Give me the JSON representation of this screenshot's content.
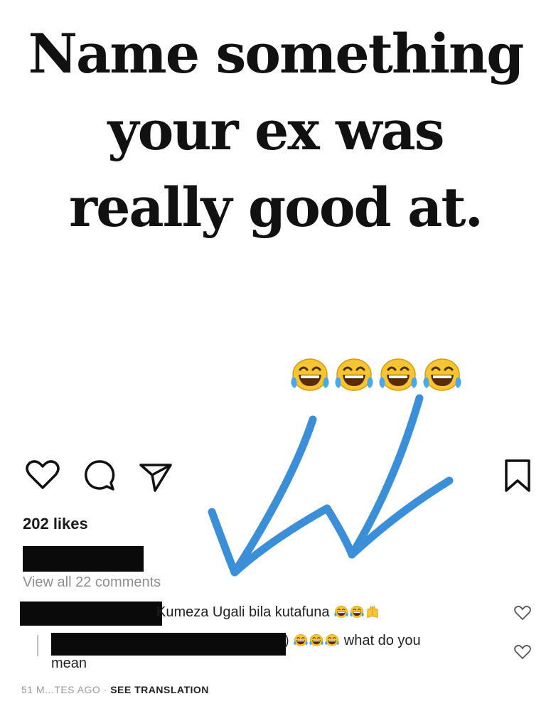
{
  "post": {
    "headline_lines": [
      "Name something",
      "your ex was",
      "really good at."
    ],
    "emoji_count": 4,
    "emoji_icon": "face-with-tears-of-joy-icon"
  },
  "actions": {
    "like_icon": "heart-icon",
    "comment_icon": "comment-bubble-icon",
    "share_icon": "paper-plane-icon",
    "save_icon": "bookmark-icon"
  },
  "likes": "202 likes",
  "view_all_comments": "View all 22 comments",
  "comments": [
    {
      "text": "Kumeza Ugali bila kutafuna",
      "emoji_icons": [
        "face-with-tears-of-joy-icon",
        "face-with-tears-of-joy-icon",
        "raising-hands-icon"
      ]
    },
    {
      "text_inline": "what do you",
      "text_wrap": "mean",
      "emoji_icons": [
        "face-with-tears-of-joy-icon",
        "face-with-tears-of-joy-icon",
        "face-with-tears-of-joy-icon"
      ]
    }
  ],
  "meta": {
    "timestamp": "51 M...TES AGO",
    "separator": "·",
    "see_translation": "SEE TRANSLATION"
  },
  "colors": {
    "arrow_blue": "#3a8fd8",
    "redaction": "#0a0a0a",
    "muted_text": "#8e8e8e",
    "emoji_yellow": "#f7c531"
  }
}
